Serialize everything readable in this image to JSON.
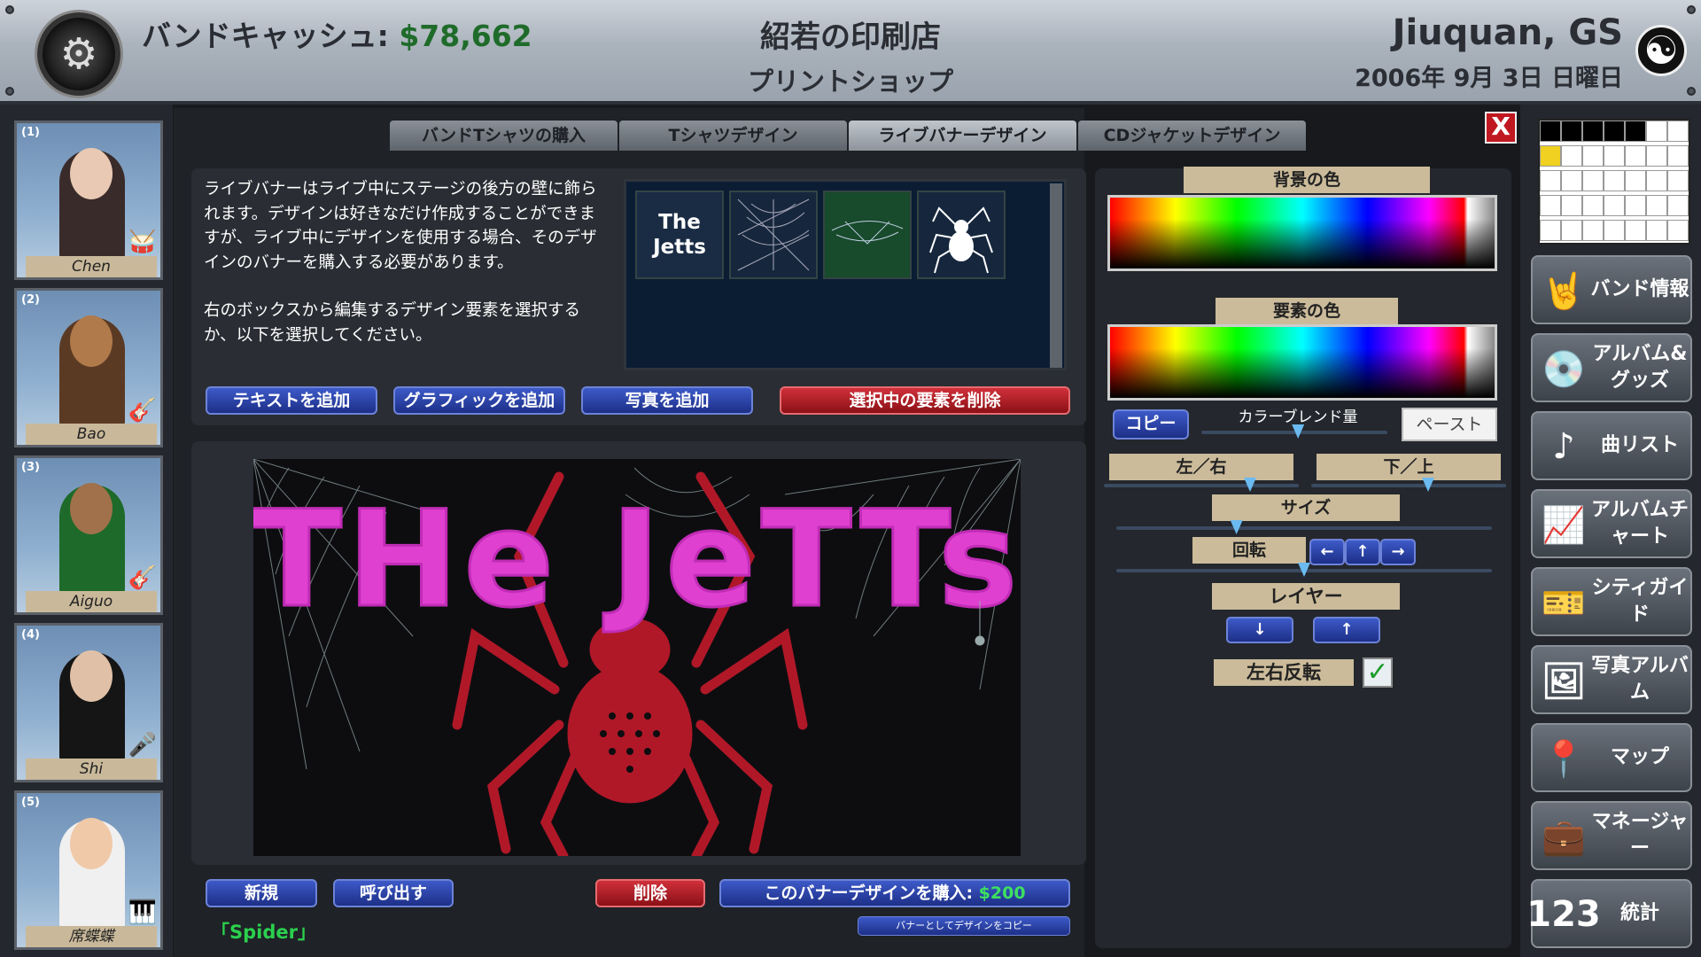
{
  "header": {
    "cash_label": "バンドキャッシュ: ",
    "cash_value": "$78,662",
    "shop_name": "紹若の印刷店",
    "shop_sub": "プリントショップ",
    "city": "Jiuquan, GS",
    "date": "2006年 9月 3日 日曜日",
    "yinyang_icon": "☯",
    "logo_icon": "⚙"
  },
  "members": [
    {
      "num": "(1)",
      "name": "Chen",
      "instrument_icon": "🥁",
      "skin": "#e9c9b4",
      "clothing": "#3a2b2b"
    },
    {
      "num": "(2)",
      "name": "Bao",
      "instrument_icon": "🎸",
      "skin": "#b07a4a",
      "clothing": "#5b3a24"
    },
    {
      "num": "(3)",
      "name": "Aiguo",
      "instrument_icon": "🎸",
      "skin": "#a0714a",
      "clothing": "#1e6a2a"
    },
    {
      "num": "(4)",
      "name": "Shi",
      "instrument_icon": "🎤",
      "skin": "#e0c0a6",
      "clothing": "#151515"
    },
    {
      "num": "(5)",
      "name": "席蝶蝶",
      "instrument_icon": "🎹",
      "skin": "#f0c9a8",
      "clothing": "#f0f0f0"
    }
  ],
  "tabs": [
    "バンドTシャツの購入",
    "Tシャツデザイン",
    "ライブバナーデザイン",
    "CDジャケットデザイン"
  ],
  "close_label": "X",
  "info_text": "ライブバナーはライブ中にステージの後方の壁に飾られます。デザインは好きなだけ作成することができますが、ライブ中にデザインを使用する場合、そのデザインのバナーを購入する必要があります。",
  "info_text2": "右のボックスから編集するデザイン要素を選択するか、以下を選択してください。",
  "thumbnails": {
    "t1": "The Jetts"
  },
  "buttons": {
    "add_text": "テキストを追加",
    "add_graphic": "グラフィックを追加",
    "add_photo": "写真を追加",
    "delete_selected": "選択中の要素を削除",
    "new": "新規",
    "load": "呼び出す",
    "delete": "削除",
    "buy_label": "このバナーデザインを購入: ",
    "buy_price": "$200",
    "copy_as_banner": "バナーとしてデザインをコピー"
  },
  "banner_text": "THe JeTTs",
  "design_name": "「Spider」",
  "right": {
    "bg_color": "背景の色",
    "element_color": "要素の色",
    "copy": "コピー",
    "blend": "カラーブレンド量",
    "paste": "ペースト",
    "left_right": "左／右",
    "down_up": "下／上",
    "size": "サイズ",
    "rotate": "回転",
    "layer": "レイヤー",
    "flip": "左右反転",
    "check": "✓",
    "arrow_left": "←",
    "arrow_up": "↑",
    "arrow_right": "→",
    "layer_down": "↓",
    "layer_up": "↑",
    "slider_levels": {
      "blend": 0.52,
      "left_right": 0.75,
      "down_up": 0.6,
      "size": 0.32,
      "rotate": 0.5
    }
  },
  "menu": [
    {
      "icon": "🤘",
      "label": "バンド情報"
    },
    {
      "icon": "💿",
      "label": "アルバム&グッズ"
    },
    {
      "icon": "♪",
      "label": "曲リスト"
    },
    {
      "icon": "📈",
      "label": "アルバムチャート"
    },
    {
      "icon": "🎫",
      "label": "シティガイド"
    },
    {
      "icon": "🖼",
      "label": "写真アルバム"
    },
    {
      "icon": "📍",
      "label": "マップ"
    },
    {
      "icon": "💼",
      "label": "マネージャー"
    },
    {
      "icon": "123",
      "label": "統計"
    }
  ],
  "colors": {
    "banner_text": "#e040d0",
    "spider": "#b01828",
    "money": "#1f6b2a"
  }
}
